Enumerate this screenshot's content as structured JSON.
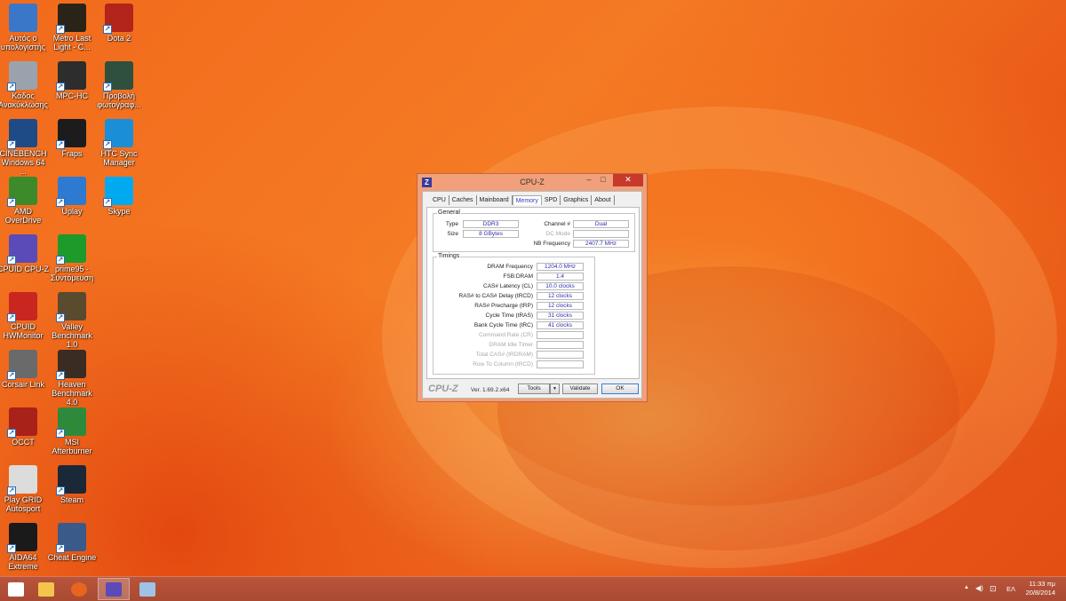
{
  "desktop": {
    "icons": [
      {
        "label": "Αυτός ο υπολογιστής",
        "icon": "computer-icon",
        "color": "#3b77c9"
      },
      {
        "label": "Metro Last Light - C...",
        "icon": "metro-game-icon",
        "color": "#2a2418"
      },
      {
        "label": "Dota 2",
        "icon": "dota2-icon",
        "color": "#b3241a"
      },
      {
        "label": "Κάδος Ανακύκλωσης",
        "icon": "recycle-bin-icon",
        "color": "#9aa3ad"
      },
      {
        "label": "MPC-HC",
        "icon": "mpc-hc-icon",
        "color": "#2d2d2d"
      },
      {
        "label": "Προβολή φωτογραφ...",
        "icon": "photo-viewer-icon",
        "color": "#2f4f3f"
      },
      {
        "label": "CINEBENCH Windows 64 ...",
        "icon": "cinebench-icon",
        "color": "#1e4a86"
      },
      {
        "label": "Fraps",
        "icon": "fraps-icon",
        "color": "#1c1c1c"
      },
      {
        "label": "HTC Sync Manager",
        "icon": "htc-sync-icon",
        "color": "#1a8fd8"
      },
      {
        "label": "AMD OverDrive",
        "icon": "amd-overdrive-icon",
        "color": "#3d8a2a"
      },
      {
        "label": "Uplay",
        "icon": "uplay-icon",
        "color": "#2d7ad0"
      },
      {
        "label": "Skype",
        "icon": "skype-icon",
        "color": "#00a9f0"
      },
      {
        "label": "CPUID CPU-Z",
        "icon": "cpuz-icon",
        "color": "#5a4bb8"
      },
      {
        "label": "prime95 - Συντόμευση",
        "icon": "prime95-icon",
        "color": "#1e9a2a"
      },
      {
        "label": "CPUID HWMonitor",
        "icon": "hwmonitor-icon",
        "color": "#c8261e"
      },
      {
        "label": "Valley Benchmark 1.0",
        "icon": "valley-icon",
        "color": "#5a4a2e"
      },
      {
        "label": "Corsair Link",
        "icon": "corsair-link-icon",
        "color": "#6a6a6a"
      },
      {
        "label": "Heaven Benchmark 4.0",
        "icon": "heaven-icon",
        "color": "#3a2c22"
      },
      {
        "label": "OCCT",
        "icon": "occt-icon",
        "color": "#a8221a"
      },
      {
        "label": "MSI Afterburner",
        "icon": "msi-afterburner-icon",
        "color": "#2e8a3a"
      },
      {
        "label": "Play GRID Autosport",
        "icon": "grid-autosport-icon",
        "color": "#dcdcdc"
      },
      {
        "label": "Steam",
        "icon": "steam-icon",
        "color": "#1b2838"
      },
      {
        "label": "AIDA64 Extreme",
        "icon": "aida64-icon",
        "color": "#1a1a1a"
      },
      {
        "label": "Cheat Engine",
        "icon": "cheat-engine-icon",
        "color": "#3a5a8a"
      }
    ]
  },
  "cpuz": {
    "app_icon": "Z",
    "title": "CPU-Z",
    "min_glyph": "–",
    "max_glyph": "□",
    "close_glyph": "✕",
    "tabs": [
      "CPU",
      "Caches",
      "Mainboard",
      "Memory",
      "SPD",
      "Graphics",
      "About"
    ],
    "active_tab": "Memory",
    "general": {
      "legend": "General",
      "type_label": "Type",
      "type_value": "DDR3",
      "size_label": "Size",
      "size_value": "8 GBytes",
      "channel_label": "Channel #",
      "channel_value": "Dual",
      "dc_label": "DC Mode",
      "dc_value": "",
      "nb_label": "NB Frequency",
      "nb_value": "2407.7 MHz"
    },
    "timings": {
      "legend": "Timings",
      "rows": [
        {
          "label": "DRAM Frequency",
          "value": "1204.0 MHz",
          "enabled": true
        },
        {
          "label": "FSB:DRAM",
          "value": "1:4",
          "enabled": true
        },
        {
          "label": "CAS# Latency (CL)",
          "value": "10.0 clocks",
          "enabled": true
        },
        {
          "label": "RAS# to CAS# Delay (tRCD)",
          "value": "12 clocks",
          "enabled": true
        },
        {
          "label": "RAS# Precharge (tRP)",
          "value": "12 clocks",
          "enabled": true
        },
        {
          "label": "Cycle Time (tRAS)",
          "value": "31 clocks",
          "enabled": true
        },
        {
          "label": "Bank Cycle Time (tRC)",
          "value": "41 clocks",
          "enabled": true
        },
        {
          "label": "Command Rate (CR)",
          "value": "",
          "enabled": false
        },
        {
          "label": "DRAM Idle Timer",
          "value": "",
          "enabled": false
        },
        {
          "label": "Total CAS# (tRDRAM)",
          "value": "",
          "enabled": false
        },
        {
          "label": "Row To Column (tRCD)",
          "value": "",
          "enabled": false
        }
      ]
    },
    "footer": {
      "brand": "CPU-Z",
      "version": "Ver. 1.69.2.x64",
      "tools_label": "Tools",
      "dropdown_glyph": "▼",
      "validate_label": "Validate",
      "ok_label": "OK"
    }
  },
  "taskbar": {
    "items": [
      {
        "icon": "start-windows-icon",
        "active": false
      },
      {
        "icon": "file-explorer-icon",
        "active": false
      },
      {
        "icon": "firefox-icon",
        "active": false
      },
      {
        "icon": "cpuz-taskbar-icon",
        "active": true
      },
      {
        "icon": "paint-icon",
        "active": false
      }
    ],
    "tray": {
      "chevron": "▲",
      "volume": "◀)",
      "network": "⊡",
      "language": "ΕΛ"
    },
    "clock_time": "11:33 πμ",
    "clock_date": "20/8/2014"
  }
}
